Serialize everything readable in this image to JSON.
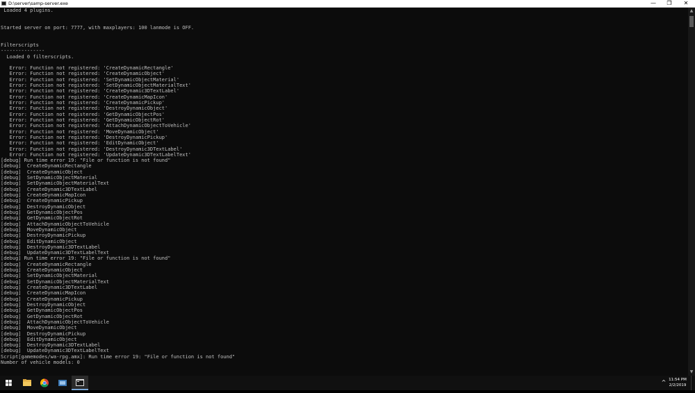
{
  "window": {
    "title": "D:\\server\\samp-server.exe",
    "minimize_glyph": "—",
    "maximize_glyph": "❐",
    "close_glyph": "✕"
  },
  "console": {
    "lines": [
      " Loaded 4 plugins.",
      "",
      "",
      "Started server on port: 7777, with maxplayers: 100 lanmode is OFF.",
      "",
      "",
      "Filterscripts",
      "---------------",
      "  Loaded 0 filterscripts.",
      "",
      "   Error: Function not registered: 'CreateDynamicRectangle'",
      "   Error: Function not registered: 'CreateDynamicObject'",
      "   Error: Function not registered: 'SetDynamicObjectMaterial'",
      "   Error: Function not registered: 'SetDynamicObjectMaterialText'",
      "   Error: Function not registered: 'CreateDynamic3DTextLabel'",
      "   Error: Function not registered: 'CreateDynamicMapIcon'",
      "   Error: Function not registered: 'CreateDynamicPickup'",
      "   Error: Function not registered: 'DestroyDynamicObject'",
      "   Error: Function not registered: 'GetDynamicObjectPos'",
      "   Error: Function not registered: 'GetDynamicObjectRot'",
      "   Error: Function not registered: 'AttachDynamicObjectToVehicle'",
      "   Error: Function not registered: 'MoveDynamicObject'",
      "   Error: Function not registered: 'DestroyDynamicPickup'",
      "   Error: Function not registered: 'EditDynamicObject'",
      "   Error: Function not registered: 'DestroyDynamic3DTextLabel'",
      "   Error: Function not registered: 'UpdateDynamic3DTextLabelText'",
      "[debug] Run time error 19: \"File or function is not found\"",
      "[debug]  CreateDynamicRectangle",
      "[debug]  CreateDynamicObject",
      "[debug]  SetDynamicObjectMaterial",
      "[debug]  SetDynamicObjectMaterialText",
      "[debug]  CreateDynamic3DTextLabel",
      "[debug]  CreateDynamicMapIcon",
      "[debug]  CreateDynamicPickup",
      "[debug]  DestroyDynamicObject",
      "[debug]  GetDynamicObjectPos",
      "[debug]  GetDynamicObjectRot",
      "[debug]  AttachDynamicObjectToVehicle",
      "[debug]  MoveDynamicObject",
      "[debug]  DestroyDynamicPickup",
      "[debug]  EditDynamicObject",
      "[debug]  DestroyDynamic3DTextLabel",
      "[debug]  UpdateDynamic3DTextLabelText",
      "[debug] Run time error 19: \"File or function is not found\"",
      "[debug]  CreateDynamicRectangle",
      "[debug]  CreateDynamicObject",
      "[debug]  SetDynamicObjectMaterial",
      "[debug]  SetDynamicObjectMaterialText",
      "[debug]  CreateDynamic3DTextLabel",
      "[debug]  CreateDynamicMapIcon",
      "[debug]  CreateDynamicPickup",
      "[debug]  DestroyDynamicObject",
      "[debug]  GetDynamicObjectPos",
      "[debug]  GetDynamicObjectRot",
      "[debug]  AttachDynamicObjectToVehicle",
      "[debug]  MoveDynamicObject",
      "[debug]  DestroyDynamicPickup",
      "[debug]  EditDynamicObject",
      "[debug]  DestroyDynamic3DTextLabel",
      "[debug]  UpdateDynamic3DTextLabelText",
      "Script[gamemodes/wa-rpg.amx]: Run time error 19: \"File or function is not found\"",
      "Number of vehicle models: 0"
    ]
  },
  "taskbar": {
    "items": [
      {
        "name": "start-button",
        "icon": "windows-logo-icon"
      },
      {
        "name": "file-explorer",
        "icon": "folder-icon"
      },
      {
        "name": "chrome",
        "icon": "chrome-icon"
      },
      {
        "name": "network-app",
        "icon": "network-icon"
      },
      {
        "name": "console-window",
        "icon": "console-icon"
      }
    ],
    "tray_chevron": "^",
    "time": "11:54 PM",
    "date": "2/2/2019"
  },
  "colors": {
    "console_bg": "#0c0c0c",
    "console_text": "#c0c0c0",
    "taskbar_bg": "#101010",
    "active_indicator": "#7aa7d8"
  }
}
